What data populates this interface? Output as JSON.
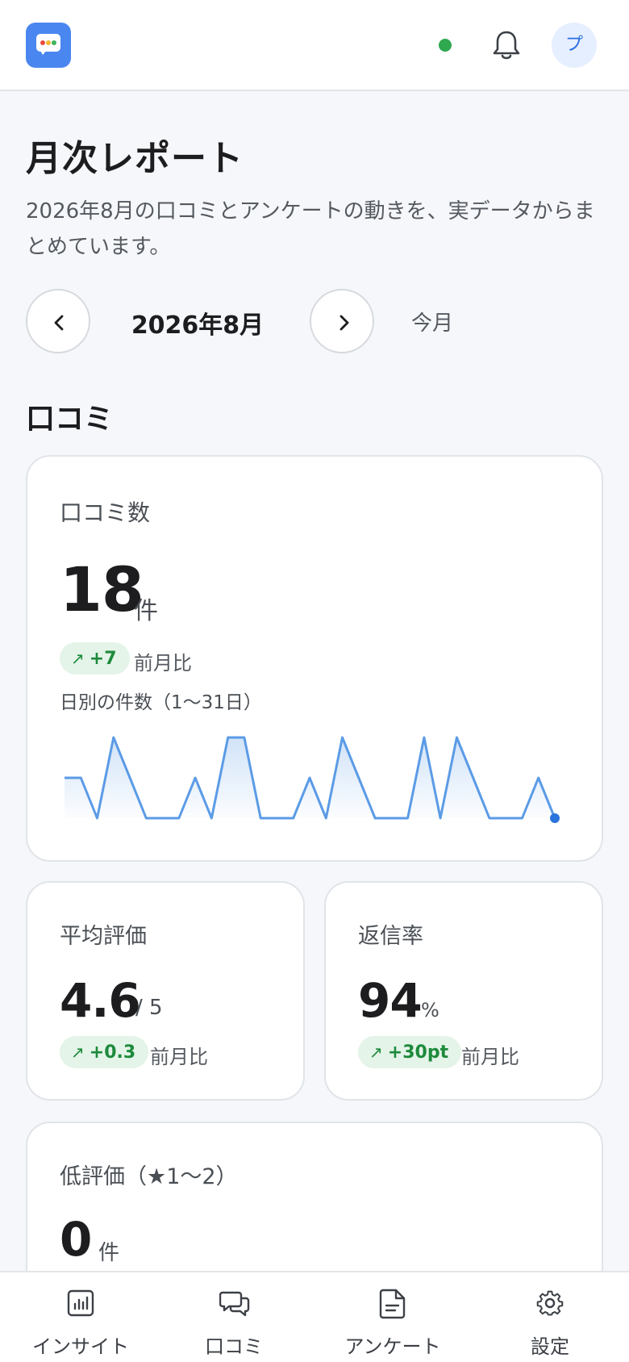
{
  "header": {
    "logo_icon": "chat-bubble-logo-icon",
    "status_color": "#2fa84f",
    "bell_icon": "bell-icon",
    "avatar_initial": "プ"
  },
  "page": {
    "title": "月次レポート",
    "description": "2026年8月の口コミとアンケートの動きを、実データからまとめています。"
  },
  "month_nav": {
    "prev_icon": "chevron-left-icon",
    "current_month": "2026年8月",
    "next_icon": "chevron-right-icon",
    "today_label": "今月"
  },
  "sections": {
    "reviews_title": "口コミ"
  },
  "review_count_card": {
    "label": "口コミ数",
    "value": "18",
    "unit": "件",
    "delta": "+7",
    "compare_label": "前月比",
    "chart_caption": "日別の件数（1〜31日）"
  },
  "avg_rating_card": {
    "label": "平均評価",
    "value": "4.6",
    "unit": "/ 5",
    "delta": "+0.3",
    "compare_label": "前月比"
  },
  "reply_rate_card": {
    "label": "返信率",
    "value": "94",
    "unit": "%",
    "delta": "+30pt",
    "compare_label": "前月比"
  },
  "low_rating_card": {
    "label": "低評価（★1〜2）",
    "value": "0",
    "unit": "件"
  },
  "chart_data": {
    "type": "area",
    "x": [
      1,
      2,
      3,
      4,
      5,
      6,
      7,
      8,
      9,
      10,
      11,
      12,
      13,
      14,
      15,
      16,
      17,
      18,
      19,
      20,
      21,
      22,
      23,
      24,
      25,
      26,
      27,
      28,
      29,
      30,
      31
    ],
    "values": [
      1,
      1,
      0,
      2,
      1,
      0,
      0,
      0,
      1,
      0,
      2,
      2,
      0,
      0,
      0,
      1,
      0,
      2,
      1,
      0,
      0,
      0,
      2,
      0,
      2,
      1,
      0,
      0,
      0,
      1,
      0
    ],
    "line_color": "#5b9be6",
    "last_point_color": "#2b74de"
  },
  "bottom_nav": {
    "items": [
      {
        "label": "インサイト",
        "icon": "bar-chart-icon"
      },
      {
        "label": "口コミ",
        "icon": "chat-bubbles-icon"
      },
      {
        "label": "アンケート",
        "icon": "document-icon"
      },
      {
        "label": "設定",
        "icon": "gear-icon"
      }
    ]
  }
}
